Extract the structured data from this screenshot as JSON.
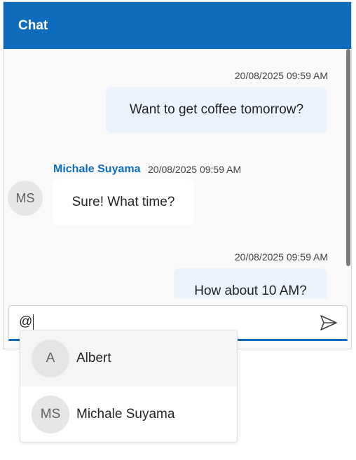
{
  "header": {
    "title": "Chat"
  },
  "messages": [
    {
      "direction": "outgoing",
      "timestamp": "20/08/2025 09:59 AM",
      "text": "Want to get coffee tomorrow?"
    },
    {
      "direction": "incoming",
      "sender": "Michale Suyama",
      "avatar": "MS",
      "timestamp": "20/08/2025 09:59 AM",
      "text": "Sure! What time?"
    },
    {
      "direction": "outgoing",
      "timestamp": "20/08/2025 09:59 AM",
      "text": "How about 10 AM?"
    }
  ],
  "input": {
    "value": "@",
    "send_icon": "send-icon"
  },
  "mention_list": [
    {
      "initials": "A",
      "name": "Albert"
    },
    {
      "initials": "MS",
      "name": "Michale Suyama"
    }
  ],
  "colors": {
    "accent": "#0f6cbd",
    "outgoing_bubble": "#ebf3fc",
    "incoming_bubble": "#ffffff"
  }
}
